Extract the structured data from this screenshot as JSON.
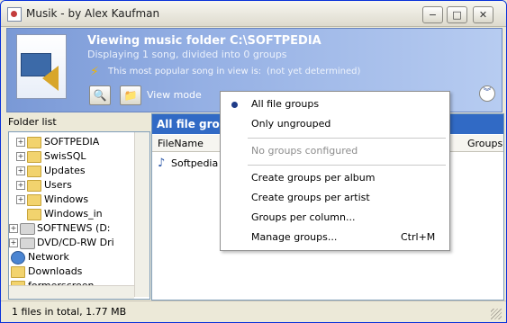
{
  "window": {
    "title": "Musik - by Alex Kaufman",
    "min_label": "−",
    "max_label": "□",
    "close_label": "✕"
  },
  "banner": {
    "title": "Viewing music folder C:\\SOFTPEDIA",
    "subtitle": "Displaying 1 song, divided into 0 groups",
    "popular_label": "This most popular song in view is:",
    "popular_value": "(not yet determined)",
    "view_mode_label": "View mode"
  },
  "folder_list": {
    "header": "Folder list",
    "items": [
      {
        "label": "SOFTPEDIA",
        "icon": "folder-icon",
        "expander": "+"
      },
      {
        "label": "SwisSQL",
        "icon": "folder-icon",
        "expander": "+"
      },
      {
        "label": "Updates",
        "icon": "folder-icon",
        "expander": "+"
      },
      {
        "label": "Users",
        "icon": "folder-icon",
        "expander": "+"
      },
      {
        "label": "Windows",
        "icon": "folder-icon",
        "expander": "+"
      },
      {
        "label": "Windows_in",
        "icon": "folder-icon",
        "expander": ""
      },
      {
        "label": "SOFTNEWS (D:",
        "icon": "drive-icon",
        "expander": "+"
      },
      {
        "label": "DVD/CD-RW Dri",
        "icon": "drive-icon",
        "expander": "+"
      },
      {
        "label": "Network",
        "icon": "network-icon",
        "expander": ""
      },
      {
        "label": "Downloads",
        "icon": "folder-icon",
        "expander": ""
      },
      {
        "label": "formerscreen",
        "icon": "folder-icon",
        "expander": ""
      }
    ]
  },
  "file_view": {
    "group_title": "All file grou",
    "columns": [
      "FileName",
      "Groups"
    ],
    "rows": [
      {
        "filename": "Softpedia"
      }
    ]
  },
  "popup_menu": {
    "items": [
      {
        "label": "All file groups",
        "checked": true
      },
      {
        "label": "Only ungrouped"
      },
      {
        "label": "No groups configured",
        "disabled": true
      },
      {
        "label": "Create groups per album"
      },
      {
        "label": "Create groups per artist"
      },
      {
        "label": "Groups per column..."
      },
      {
        "label": "Manage groups...",
        "shortcut": "Ctrl+M"
      }
    ]
  },
  "statusbar": {
    "text": "1 files in total, 1.77 MB"
  },
  "colors": {
    "banner_start": "#7a99d6",
    "banner_end": "#b7ccf1",
    "group_bar": "#316ac5"
  }
}
